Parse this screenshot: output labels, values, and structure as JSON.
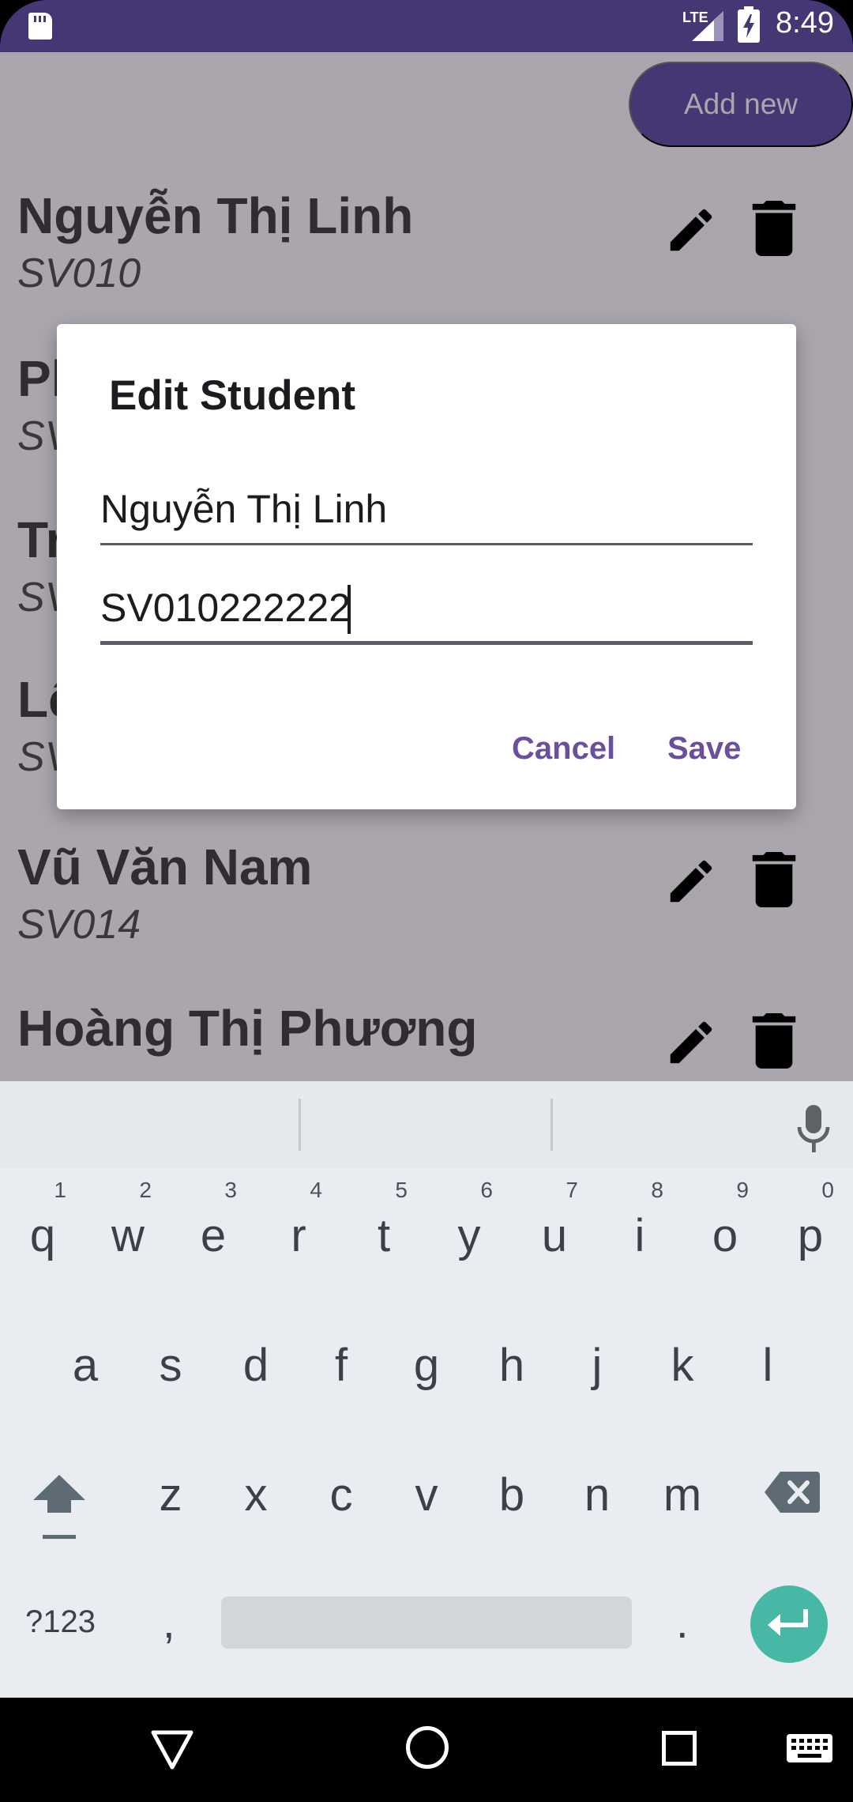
{
  "status_bar": {
    "network": "LTE",
    "time": "8:49",
    "icons": [
      "sd-card-icon",
      "signal-icon",
      "battery-charging-icon"
    ]
  },
  "app": {
    "add_new_label": "Add new",
    "students": [
      {
        "name": "Nguyễn Thị Linh",
        "id": "SV010"
      },
      {
        "name": "Ph",
        "id": "SV"
      },
      {
        "name": "Tr",
        "id": "SV"
      },
      {
        "name": "Lê",
        "id": "SV"
      },
      {
        "name": "Vũ Văn Nam",
        "id": "SV014"
      },
      {
        "name": "Hoàng Thị Phương",
        "id": ""
      }
    ]
  },
  "dialog": {
    "title": "Edit Student",
    "name_value": "Nguyễn Thị Linh",
    "id_value": "SV010222222",
    "cancel_label": "Cancel",
    "save_label": "Save"
  },
  "keyboard": {
    "row1": [
      {
        "ch": "q",
        "num": "1"
      },
      {
        "ch": "w",
        "num": "2"
      },
      {
        "ch": "e",
        "num": "3"
      },
      {
        "ch": "r",
        "num": "4"
      },
      {
        "ch": "t",
        "num": "5"
      },
      {
        "ch": "y",
        "num": "6"
      },
      {
        "ch": "u",
        "num": "7"
      },
      {
        "ch": "i",
        "num": "8"
      },
      {
        "ch": "o",
        "num": "9"
      },
      {
        "ch": "p",
        "num": "0"
      }
    ],
    "row2": [
      "a",
      "s",
      "d",
      "f",
      "g",
      "h",
      "j",
      "k",
      "l"
    ],
    "row3": [
      "z",
      "x",
      "c",
      "v",
      "b",
      "n",
      "m"
    ],
    "symbols_label": "?123",
    "comma": ",",
    "period": ".",
    "enter_color": "#47b8a5"
  },
  "colors": {
    "primary": "#453674",
    "accent": "#6a4f9c",
    "scrim": "#aba6ae"
  }
}
